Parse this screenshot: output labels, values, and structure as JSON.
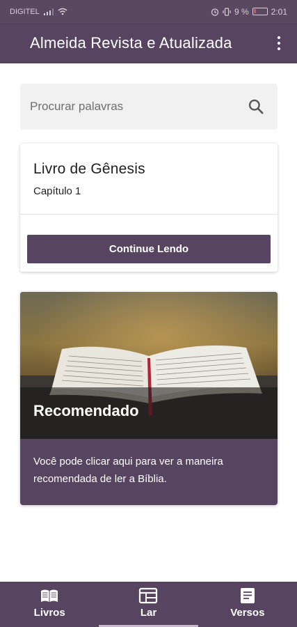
{
  "status_bar": {
    "carrier": "DIGITEL",
    "battery": "9 %",
    "time": "2:01"
  },
  "app_bar": {
    "title": "Almeida Revista e Atualizada",
    "menu_icon": "more-vert-icon"
  },
  "search": {
    "placeholder": "Procurar palavras",
    "icon": "search-icon"
  },
  "continue_card": {
    "book": "Livro de Gênesis",
    "chapter": "Capítulo 1",
    "button_label": "Continue Lendo"
  },
  "recommended_card": {
    "title": "Recomendado",
    "description": "Você pode clicar aqui para ver a maneira recomendada de ler a Bíblia.",
    "image": "open-bible-photo"
  },
  "bottom_nav": {
    "items": [
      {
        "label": "Livros",
        "icon": "book-icon"
      },
      {
        "label": "Lar",
        "icon": "home-dashboard-icon"
      },
      {
        "label": "Versos",
        "icon": "notes-icon"
      }
    ],
    "selected": "Lar"
  },
  "colors": {
    "primary": "#574460",
    "surface": "#ffffff",
    "search_bg": "#f1f1f1"
  }
}
